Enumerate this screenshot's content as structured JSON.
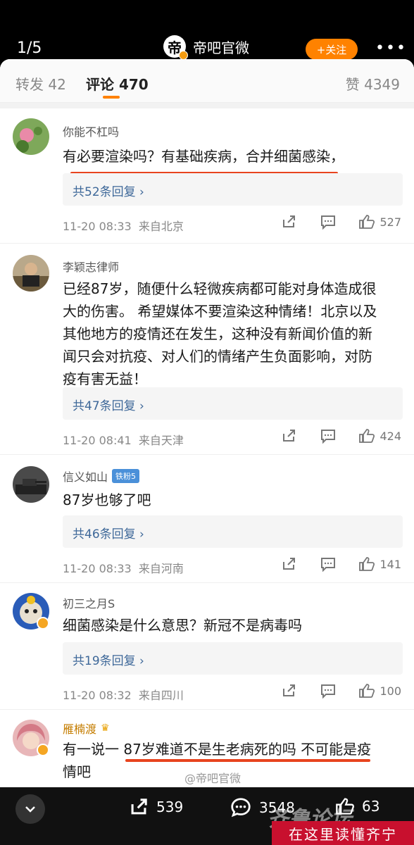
{
  "top_bar": {
    "page_indicator": "1/5",
    "account_avatar_char": "帝",
    "account_name": "帝吧官微",
    "follow_label": "+关注",
    "more_label": "•••"
  },
  "tabs": {
    "repost": "转发 42",
    "comments": "评论 470",
    "likes": "赞 4349"
  },
  "comments": [
    {
      "name": "你能不杠吗",
      "lines": [
        "有必要渲染吗？有基础疾病，合并细菌感染，"
      ],
      "replies": "共52条回复 ›",
      "time": "11-20 08:33",
      "location": "来自北京",
      "likes": "527"
    },
    {
      "name": "李颖志律师",
      "lines": [
        "已经87岁，随便什么轻微疾病都可能对身体造成很",
        "大的伤害。 希望媒体不要渲染这种情绪！北京以及",
        "其他地方的疫情还在发生，这种没有新闻价值的新",
        "闻只会对抗疫、对人们的情绪产生负面影响，对防",
        "疫有害无益！"
      ],
      "replies": "共47条回复 ›",
      "time": "11-20 08:41",
      "location": "来自天津",
      "likes": "424"
    },
    {
      "name": "信义如山",
      "badge": "铁粉5",
      "lines": [
        "87岁也够了吧"
      ],
      "replies": "共46条回复 ›",
      "time": "11-20 08:33",
      "location": "来自河南",
      "likes": "141"
    },
    {
      "name": "初三之月S",
      "lines": [
        "细菌感染是什么意思？新冠不是病毒吗"
      ],
      "replies": "共19条回复 ›",
      "time": "11-20 08:32",
      "location": "来自四川",
      "likes": "100"
    },
    {
      "name": "雁楠渡",
      "lines": [
        "有一说一 87岁难道不是生老病死的吗 不可能是疫",
        "情吧"
      ]
    }
  ],
  "bottom_bar": {
    "reposts": "539",
    "comments": "3548",
    "likes": "63"
  },
  "watermarks": {
    "credit": "@帝吧官微",
    "site": "齐鲁论坛",
    "tagline": "在这里读懂齐宁"
  },
  "colors": {
    "accent": "#ff8200",
    "underline_red": "#e8441e",
    "link_blue": "#3e6899"
  }
}
